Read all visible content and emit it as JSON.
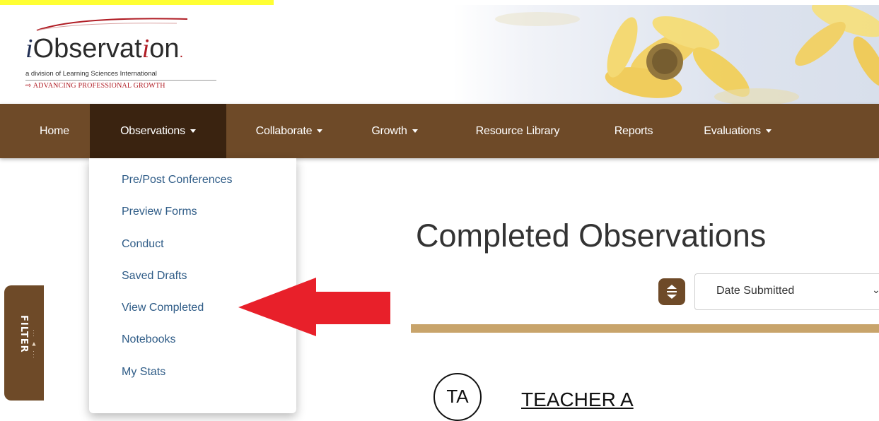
{
  "header": {
    "logo": {
      "title_i": "i",
      "title_part1": "Observat",
      "title_i2": "i",
      "title_part2": "on",
      "title_dot": ".",
      "subtitle": "a division of Learning Sciences International",
      "tagline": "⇨ ADVANCING PROFESSIONAL GROWTH"
    }
  },
  "navbar": {
    "items": [
      {
        "label": "Home",
        "has_caret": false,
        "active": false
      },
      {
        "label": "Observations",
        "has_caret": true,
        "active": true
      },
      {
        "label": "Collaborate",
        "has_caret": true,
        "active": false
      },
      {
        "label": "Growth",
        "has_caret": true,
        "active": false
      },
      {
        "label": "Resource Library",
        "has_caret": false,
        "active": false
      },
      {
        "label": "Reports",
        "has_caret": false,
        "active": false
      },
      {
        "label": "Evaluations",
        "has_caret": true,
        "active": false
      }
    ]
  },
  "dropdown": {
    "items": [
      {
        "label": "Pre/Post Conferences"
      },
      {
        "label": "Preview Forms"
      },
      {
        "label": "Conduct"
      },
      {
        "label": "Saved Drafts"
      },
      {
        "label": "View Completed"
      },
      {
        "label": "Notebooks"
      },
      {
        "label": "My Stats"
      }
    ]
  },
  "filter": {
    "label": "FILTER"
  },
  "main": {
    "title": "Completed Observations",
    "sort": {
      "selected": "Date Submitted",
      "icon": "sort-icon"
    },
    "teacher": {
      "initials": "TA",
      "name": "TEACHER A"
    }
  },
  "colors": {
    "nav_bg": "#6e4a28",
    "nav_active": "#3a2310",
    "link": "#2f5c87",
    "accent_bar": "#c8a46b",
    "arrow": "#e8202a",
    "highlight": "#ffff33"
  }
}
